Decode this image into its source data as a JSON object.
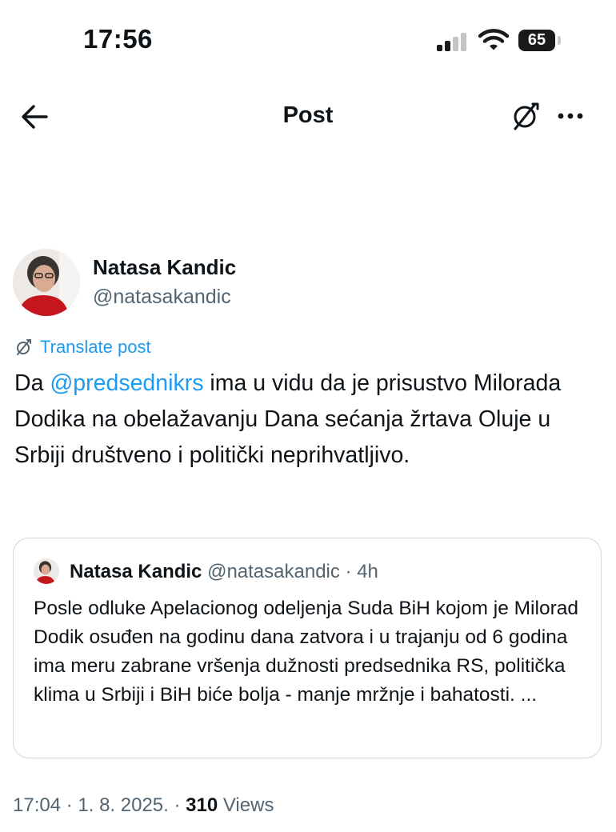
{
  "status_bar": {
    "time": "17:56",
    "battery": "65"
  },
  "header": {
    "title": "Post"
  },
  "post": {
    "author_name": "Natasa Kandic",
    "author_handle": "@natasakandic",
    "translate_label": "Translate post",
    "text_before": "Da ",
    "mention": "@predsednikrs",
    "text_after": " ima u vidu da je prisustvo Milorada Dodika na obelažavanju Dana sećanja žrtava Oluje u Srbiji društveno i politički neprihvatljivo."
  },
  "quote": {
    "author_name": "Natasa Kandic",
    "author_handle": "@natasakandic",
    "time": "· 4h",
    "text": "Posle odluke Apelacionog odeljenja Suda BiH kojom je Milorad Dodik osuđen na godinu dana zatvora i u trajanju od 6 godina ima meru zabrane vršenja dužnosti predsednika RS, politička klima u Srbiji i BiH biće bolja - manje mržnje i bahatosti. ..."
  },
  "meta": {
    "time_date": "17:04 · 1. 8. 2025. · ",
    "views_count": "310",
    "views_label": " Views"
  },
  "colors": {
    "link": "#1d9bf0",
    "secondary": "#536471",
    "border": "#cfd9de"
  },
  "icons": [
    "back-arrow-icon",
    "translate-icon",
    "more-icon",
    "signal-icon",
    "wifi-icon",
    "battery-icon"
  ]
}
